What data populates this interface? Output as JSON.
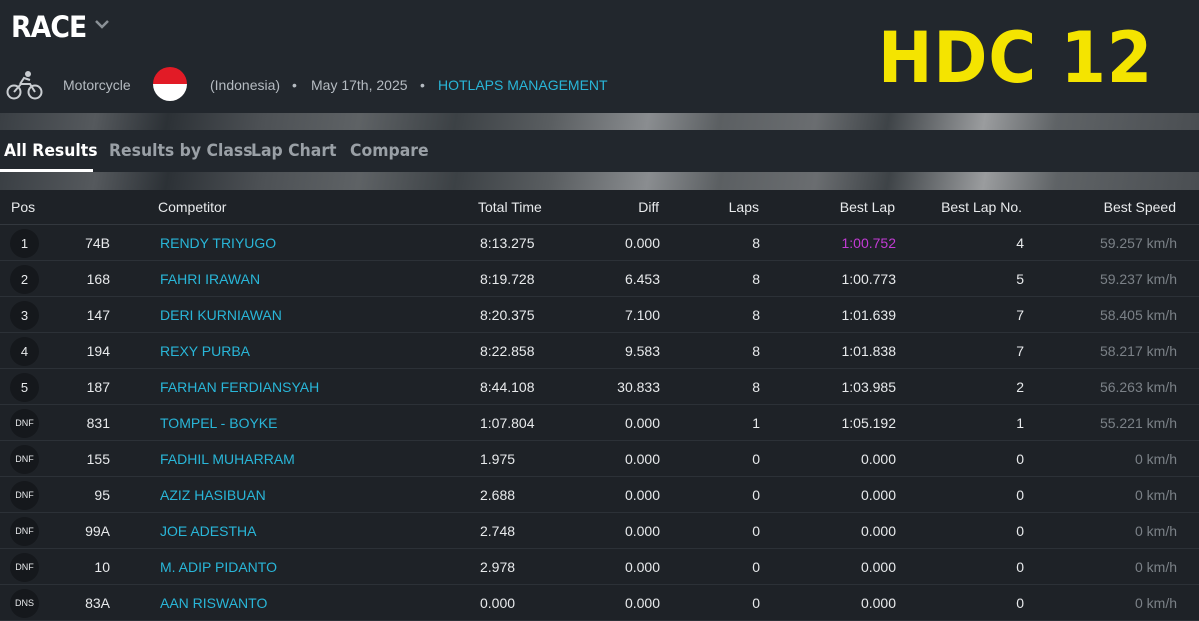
{
  "event": {
    "title": "RACE",
    "sport": "Motorcycle",
    "country": "(Indonesia)",
    "separator": "•",
    "date": "May 17th, 2025",
    "organizer": "HOTLAPS MANAGEMENT",
    "brand": "HDC 12",
    "colors": {
      "accent": "#29b6d8",
      "brand": "#f4e400",
      "best_lap_highlight": "#c23bd4"
    }
  },
  "tabs": [
    {
      "label": "All Results",
      "active": true
    },
    {
      "label": "Results by Class",
      "active": false
    },
    {
      "label": "Lap Chart",
      "active": false
    },
    {
      "label": "Compare",
      "active": false
    }
  ],
  "table": {
    "columns": [
      "Pos",
      "Competitor",
      "Total Time",
      "Diff",
      "Laps",
      "Best Lap",
      "Best Lap No.",
      "Best Speed"
    ],
    "rows": [
      {
        "pos": "1",
        "num": "74B",
        "competitor": "RENDY TRIYUGO",
        "total": "8:13.275",
        "diff": "0.000",
        "laps": "8",
        "best": "1:00.752",
        "best_no": "4",
        "speed": "59.257 km/h"
      },
      {
        "pos": "2",
        "num": "168",
        "competitor": "FAHRI IRAWAN",
        "total": "8:19.728",
        "diff": "6.453",
        "laps": "8",
        "best": "1:00.773",
        "best_no": "5",
        "speed": "59.237 km/h"
      },
      {
        "pos": "3",
        "num": "147",
        "competitor": "DERI KURNIAWAN",
        "total": "8:20.375",
        "diff": "7.100",
        "laps": "8",
        "best": "1:01.639",
        "best_no": "7",
        "speed": "58.405 km/h"
      },
      {
        "pos": "4",
        "num": "194",
        "competitor": "REXY PURBA",
        "total": "8:22.858",
        "diff": "9.583",
        "laps": "8",
        "best": "1:01.838",
        "best_no": "7",
        "speed": "58.217 km/h"
      },
      {
        "pos": "5",
        "num": "187",
        "competitor": "FARHAN FERDIANSYAH",
        "total": "8:44.108",
        "diff": "30.833",
        "laps": "8",
        "best": "1:03.985",
        "best_no": "2",
        "speed": "56.263 km/h"
      },
      {
        "pos": "DNF",
        "num": "831",
        "competitor": "TOMPEL - BOYKE",
        "total": "1:07.804",
        "diff": "0.000",
        "laps": "1",
        "best": "1:05.192",
        "best_no": "1",
        "speed": "55.221 km/h"
      },
      {
        "pos": "DNF",
        "num": "155",
        "competitor": "FADHIL MUHARRAM",
        "total": "1.975",
        "diff": "0.000",
        "laps": "0",
        "best": "0.000",
        "best_no": "0",
        "speed": "0 km/h"
      },
      {
        "pos": "DNF",
        "num": "95",
        "competitor": "AZIZ HASIBUAN",
        "total": "2.688",
        "diff": "0.000",
        "laps": "0",
        "best": "0.000",
        "best_no": "0",
        "speed": "0 km/h"
      },
      {
        "pos": "DNF",
        "num": "99A",
        "competitor": "JOE ADESTHA",
        "total": "2.748",
        "diff": "0.000",
        "laps": "0",
        "best": "0.000",
        "best_no": "0",
        "speed": "0 km/h"
      },
      {
        "pos": "DNF",
        "num": "10",
        "competitor": "M. ADIP PIDANTO",
        "total": "2.978",
        "diff": "0.000",
        "laps": "0",
        "best": "0.000",
        "best_no": "0",
        "speed": "0 km/h"
      },
      {
        "pos": "DNS",
        "num": "83A",
        "competitor": "AAN RISWANTO",
        "total": "0.000",
        "diff": "0.000",
        "laps": "0",
        "best": "0.000",
        "best_no": "0",
        "speed": "0 km/h"
      }
    ]
  }
}
